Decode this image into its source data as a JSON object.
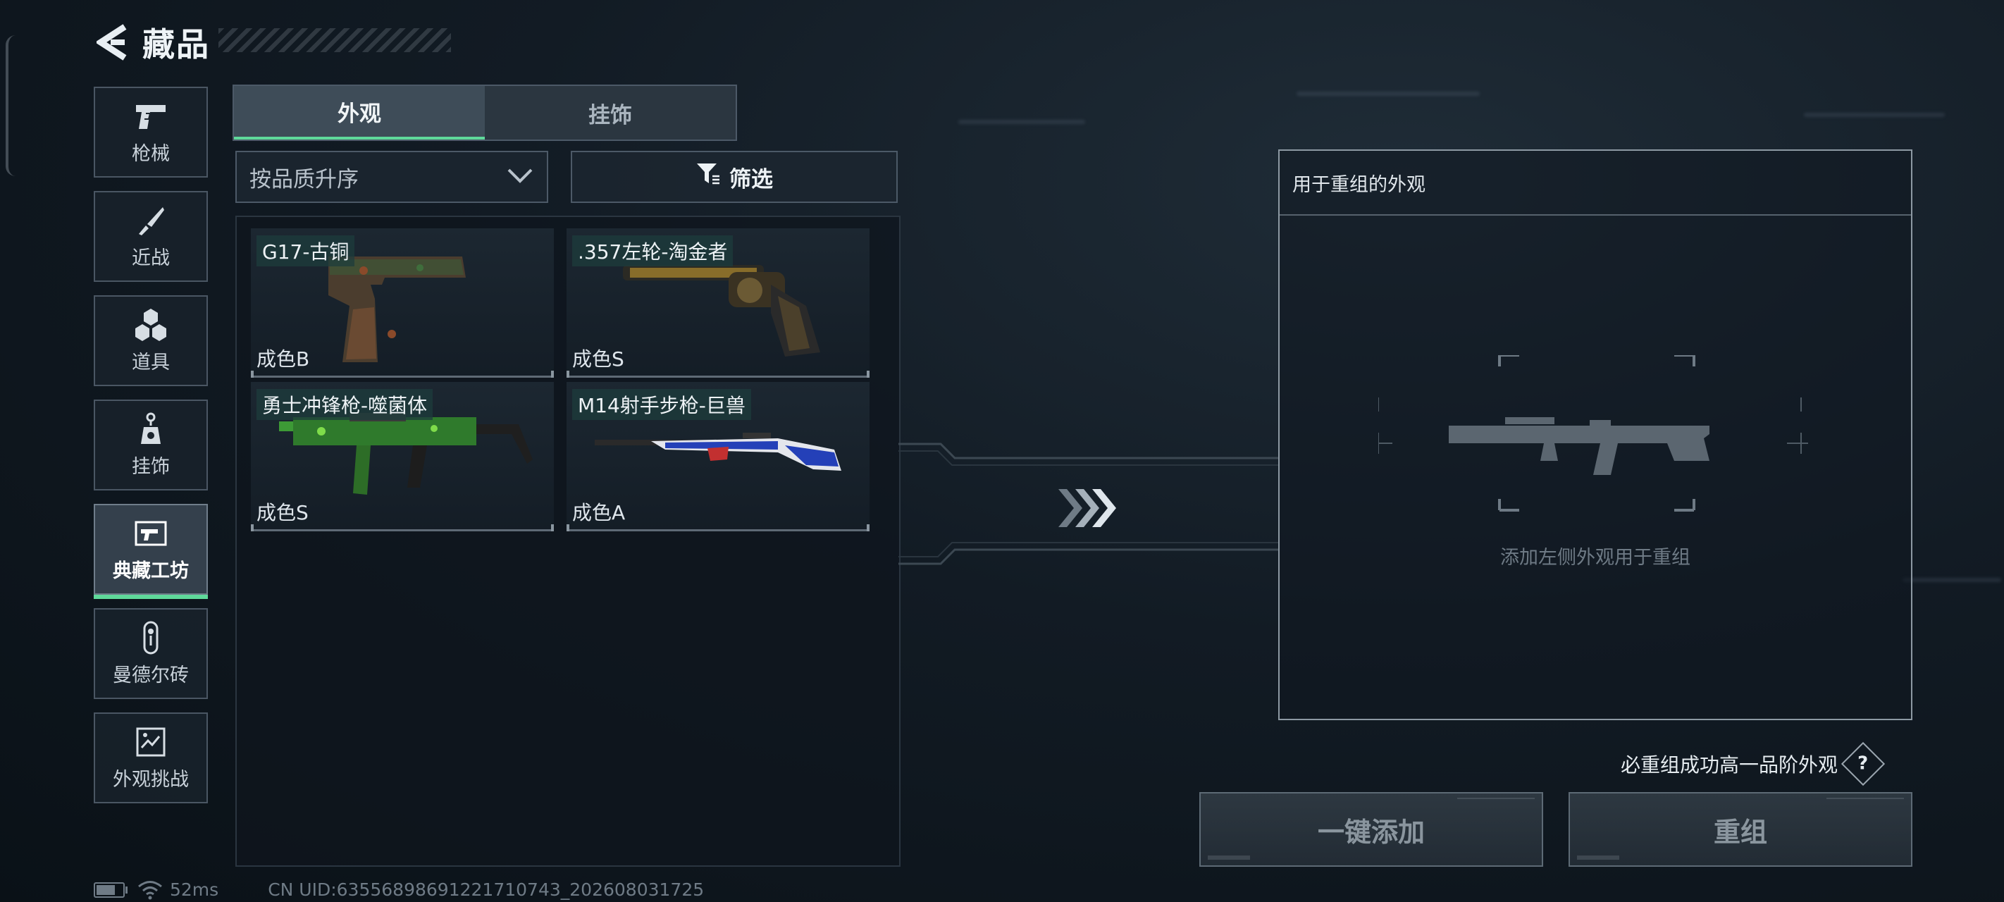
{
  "header": {
    "title": "藏品",
    "back_icon": "back-arrow-icon"
  },
  "sidebar": {
    "items": [
      {
        "label": "枪械",
        "icon": "pistol-icon"
      },
      {
        "label": "近战",
        "icon": "knife-icon"
      },
      {
        "label": "道具",
        "icon": "grenade-cluster-icon"
      },
      {
        "label": "挂饰",
        "icon": "charm-icon"
      },
      {
        "label": "典藏工坊",
        "icon": "workshop-icon",
        "active": true
      },
      {
        "label": "曼德尔砖",
        "icon": "mandel-brick-icon"
      },
      {
        "label": "外观挑战",
        "icon": "challenge-icon"
      }
    ]
  },
  "tabs": [
    {
      "label": "外观",
      "active": true
    },
    {
      "label": "挂饰",
      "active": false
    }
  ],
  "sort": {
    "value": "按品质升序"
  },
  "filter": {
    "label": "筛选"
  },
  "skins": [
    {
      "name": "G17-古铜",
      "grade": "成色B"
    },
    {
      "name": ".357左轮-淘金者",
      "grade": "成色S"
    },
    {
      "name": "勇士冲锋枪-噬菌体",
      "grade": "成色S"
    },
    {
      "name": "M14射手步枪-巨兽",
      "grade": "成色A"
    }
  ],
  "recombine": {
    "header": "用于重组的外观",
    "hint": "添加左侧外观用于重组",
    "guarantee": "必重组成功高一品阶外观",
    "help": "?",
    "add_all_label": "一键添加",
    "recombine_label": "重组"
  },
  "status": {
    "ping": "52ms",
    "uid": "CN UID:63556898691221710743_202608031725"
  },
  "colors": {
    "accent": "#5fd99a",
    "panel_border": "#4c5967"
  }
}
